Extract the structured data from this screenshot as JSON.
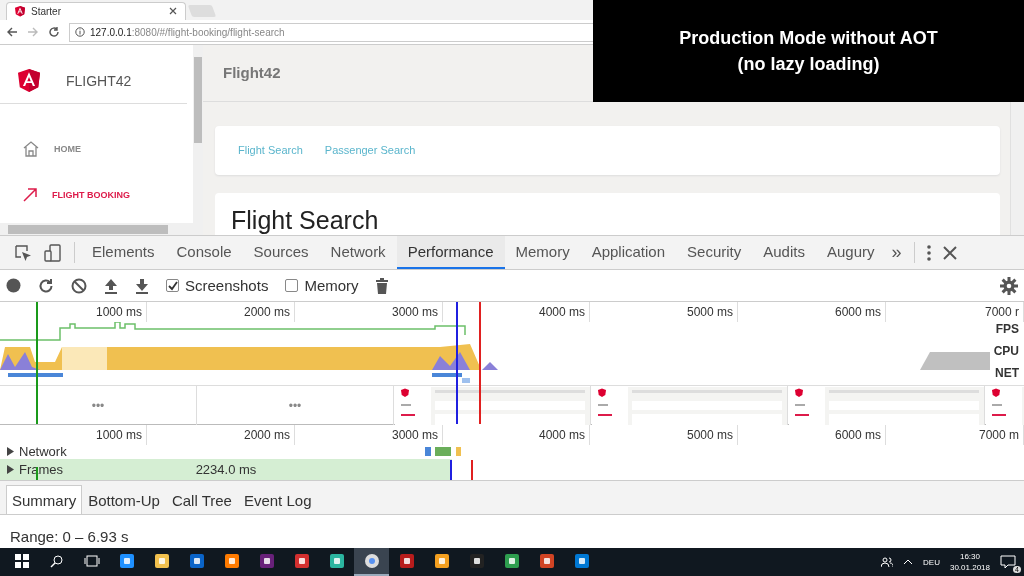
{
  "browser": {
    "tab_title": "Starter",
    "url_host": "127.0.0.1",
    "url_rest": ":8080/#/flight-booking/flight-search"
  },
  "app": {
    "brand": "FLIGHT42",
    "header_title": "Flight42",
    "nav": [
      {
        "label": "HOME",
        "selected": false,
        "kind": "home"
      },
      {
        "label": "FLIGHT BOOKING",
        "selected": true,
        "kind": "arrow"
      }
    ],
    "links": [
      "Flight Search",
      "Passenger Search"
    ],
    "heading": "Flight Search"
  },
  "overlay": {
    "lines": [
      "Production Mode without AOT",
      "(no lazy loading)"
    ]
  },
  "devtools": {
    "tabs": [
      {
        "label": "Elements",
        "selected": false
      },
      {
        "label": "Console",
        "selected": false
      },
      {
        "label": "Sources",
        "selected": false
      },
      {
        "label": "Network",
        "selected": false
      },
      {
        "label": "Performance",
        "selected": true
      },
      {
        "label": "Memory",
        "selected": false
      },
      {
        "label": "Application",
        "selected": false
      },
      {
        "label": "Security",
        "selected": false
      },
      {
        "label": "Audits",
        "selected": false
      },
      {
        "label": "Augury",
        "selected": false
      }
    ],
    "more": "»",
    "checkboxes": [
      {
        "label": "Screenshots",
        "checked": true
      },
      {
        "label": "Memory",
        "checked": false
      }
    ]
  },
  "overview": {
    "ticks": [
      "1000 ms",
      "2000 ms",
      "3000 ms",
      "4000 ms",
      "5000 ms",
      "6000 ms",
      "7000 r"
    ],
    "tracks": [
      "FPS",
      "CPU",
      "NET"
    ],
    "placeholders": [
      "•••",
      "•••"
    ]
  },
  "timeline": {
    "ticks": [
      "1000 ms",
      "2000 ms",
      "3000 ms",
      "4000 ms",
      "5000 ms",
      "6000 ms",
      "7000 m"
    ],
    "rows": [
      {
        "label": "Network",
        "expanded": false
      },
      {
        "label": "Frames",
        "expanded": false
      }
    ],
    "frame_duration": "2234.0 ms"
  },
  "bottom_tabs": [
    {
      "label": "Summary",
      "selected": true
    },
    {
      "label": "Bottom-Up",
      "selected": false
    },
    {
      "label": "Call Tree",
      "selected": false
    },
    {
      "label": "Event Log",
      "selected": false
    }
  ],
  "range": "Range: 0 – 6.93 s",
  "taskbar": {
    "apps": [
      {
        "selected": false
      },
      {
        "selected": false
      },
      {
        "selected": false
      },
      {
        "selected": false
      },
      {
        "selected": false
      },
      {
        "selected": false
      },
      {
        "selected": false
      },
      {
        "selected": true
      },
      {
        "selected": false
      },
      {
        "selected": false
      },
      {
        "selected": false
      },
      {
        "selected": false
      },
      {
        "selected": false
      },
      {
        "selected": false
      }
    ],
    "lang": "DEU",
    "time": "16:30",
    "date": "30.01.2018",
    "notifications": "4"
  }
}
